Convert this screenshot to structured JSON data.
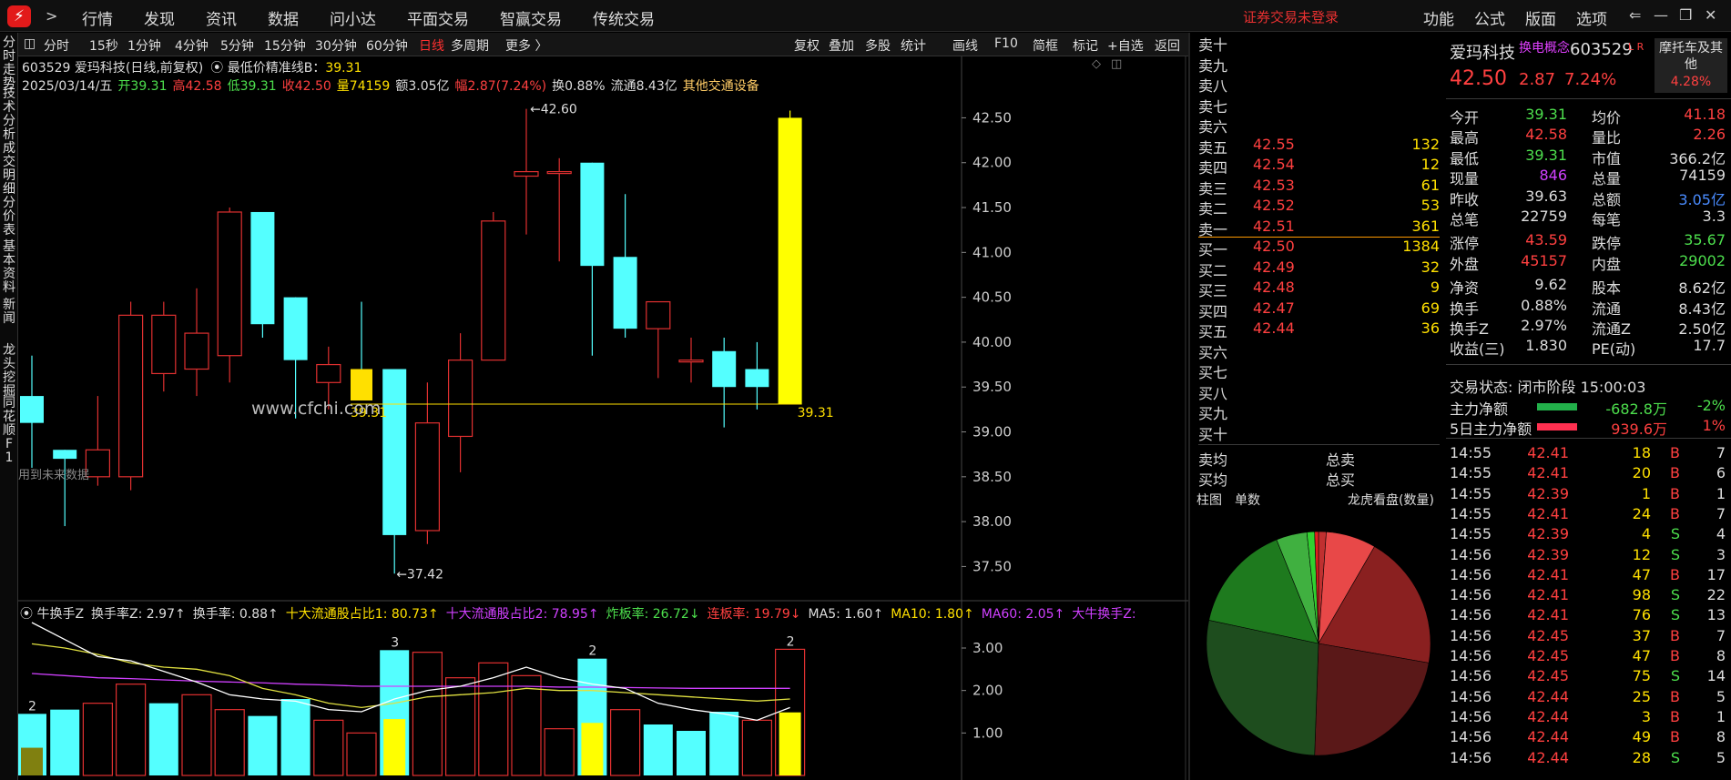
{
  "topbar": {
    "menu": [
      "行情",
      "发现",
      "资讯",
      "数据",
      "问小达",
      "平面交易",
      "智赢交易",
      "传统交易"
    ],
    "status": "证券交易未登录",
    "right_menu": [
      "功能",
      "公式",
      "版面",
      "选项"
    ]
  },
  "leftbar": [
    "分时走势",
    "技术分析",
    "成交明细",
    "分价表",
    "基本资料",
    "新闻",
    "龙头挖掘",
    "同花顺F1"
  ],
  "periods": [
    "分时",
    "15秒",
    "1分钟",
    "4分钟",
    "5分钟",
    "15分钟",
    "30分钟",
    "60分钟",
    "日线",
    "多周期",
    "更多 〉"
  ],
  "tools": [
    "复权",
    "叠加",
    "多股",
    "统计",
    "画线",
    "F10",
    "简框",
    "标记",
    "+自选",
    "返回"
  ],
  "kline_header": {
    "code_name": "603529 爱玛科技(日线,前复权)",
    "line_label": "最低价精准线B：",
    "line_value": "39.31",
    "date": "2025/03/14/五",
    "open": "开39.31",
    "high": "高42.58",
    "low": "低39.31",
    "close": "收42.50",
    "vol": "量74159",
    "amount": "额3.05亿",
    "range": "幅2.87(7.24%)",
    "turnover": "换0.88%",
    "float": "流通8.43亿",
    "industry": "其他交通设备"
  },
  "watermark": "www.cfchi.com",
  "future_note": "用到未来数据",
  "annot": {
    "high": "42.60",
    "low": "37.42",
    "line_left": "39.31",
    "line_right": "39.31"
  },
  "ind_header": {
    "name": "牛换手Z",
    "items": [
      "换手率Z: 2.97↑",
      "换手率: 0.88↑",
      "十大流通股占比1: 80.73↑",
      "十大流通股占比2: 78.95↑",
      "炸板率: 26.72↓",
      "连板率: 19.79↓",
      "MA5: 1.60↑",
      "MA10: 1.80↑",
      "MA60: 2.05↑",
      "大牛换手Z:"
    ]
  },
  "ind_labels": [
    "2",
    "3",
    "2",
    "2"
  ],
  "chart_data": [
    {
      "type": "candlestick",
      "name": "日线",
      "ylim": [
        37.2,
        42.9
      ],
      "yticks": [
        "42.50",
        "42.00",
        "41.50",
        "41.00",
        "40.50",
        "40.00",
        "39.50",
        "39.00",
        "38.50",
        "38.00",
        "37.50"
      ],
      "candles": [
        [
          39.4,
          39.1,
          39.85,
          38.6
        ],
        [
          38.8,
          38.7,
          38.8,
          37.95
        ],
        [
          38.5,
          38.8,
          39.4,
          38.4
        ],
        [
          38.5,
          40.3,
          40.45,
          38.35
        ],
        [
          39.65,
          40.3,
          40.45,
          39.45
        ],
        [
          39.7,
          40.1,
          40.6,
          39.4
        ],
        [
          39.85,
          41.45,
          41.5,
          39.55
        ],
        [
          41.45,
          40.2,
          41.45,
          40.05
        ],
        [
          40.5,
          39.8,
          40.5,
          39.15
        ],
        [
          39.55,
          39.75,
          39.95,
          39.25
        ],
        [
          39.7,
          39.35,
          40.45,
          39.35
        ],
        [
          39.7,
          37.85,
          39.7,
          37.42
        ],
        [
          37.9,
          39.1,
          39.55,
          37.75
        ],
        [
          38.95,
          39.8,
          40.1,
          38.55
        ],
        [
          39.8,
          41.35,
          41.45,
          39.8
        ],
        [
          41.85,
          41.9,
          42.6,
          41.2
        ],
        [
          41.88,
          41.9,
          42.05,
          40.9
        ],
        [
          42.0,
          40.85,
          42.0,
          39.85
        ],
        [
          40.95,
          40.15,
          41.65,
          40.05
        ],
        [
          40.15,
          40.45,
          40.45,
          39.6
        ],
        [
          39.8,
          39.8,
          40.05,
          39.55
        ],
        [
          39.9,
          39.5,
          40.05,
          39.05
        ],
        [
          39.7,
          39.5,
          40.0,
          39.25
        ],
        [
          39.31,
          42.5,
          42.58,
          39.31
        ]
      ]
    },
    {
      "type": "bar",
      "name": "换手率Z",
      "ylim": [
        0,
        3.6
      ],
      "yticks": [
        "3.00",
        "2.00",
        "1.00"
      ],
      "values": [
        1.45,
        1.55,
        1.7,
        2.15,
        1.7,
        1.9,
        1.55,
        1.4,
        1.8,
        1.3,
        1.0,
        2.95,
        2.9,
        2.3,
        2.65,
        2.35,
        1.1,
        2.75,
        1.55,
        1.2,
        1.05,
        1.5,
        1.3,
        2.97
      ],
      "ma_white": [
        3.6,
        3.2,
        2.8,
        2.7,
        2.45,
        2.2,
        1.9,
        1.8,
        1.75,
        1.55,
        1.5,
        1.8,
        2.0,
        2.1,
        2.3,
        2.55,
        2.3,
        2.15,
        2.05,
        1.7,
        1.55,
        1.45,
        1.3,
        1.6
      ],
      "ma_yellow": [
        3.1,
        3.0,
        2.85,
        2.65,
        2.55,
        2.5,
        2.35,
        2.05,
        1.9,
        1.7,
        1.6,
        1.7,
        1.85,
        1.9,
        1.95,
        2.05,
        2.0,
        2.0,
        1.95,
        1.9,
        1.85,
        1.8,
        1.75,
        1.8
      ],
      "ma_purple": [
        2.4,
        2.35,
        2.3,
        2.28,
        2.25,
        2.22,
        2.2,
        2.18,
        2.15,
        2.13,
        2.1,
        2.1,
        2.1,
        2.1,
        2.1,
        2.1,
        2.08,
        2.08,
        2.07,
        2.06,
        2.05,
        2.05,
        2.05,
        2.05
      ]
    }
  ],
  "stock": {
    "name": "爱玛科技",
    "concept": "换电概念",
    "code": "603529",
    "flags": "L R",
    "side": "摩托车及其他",
    "side_pct": "4.28%",
    "price": "42.50",
    "chg": "2.87",
    "pct": "7.24%"
  },
  "order_book": {
    "sells": [
      [
        "卖十",
        "",
        ""
      ],
      [
        "卖九",
        "",
        ""
      ],
      [
        "卖八",
        "",
        ""
      ],
      [
        "卖七",
        "",
        ""
      ],
      [
        "卖六",
        "",
        ""
      ],
      [
        "卖五",
        "42.55",
        "132"
      ],
      [
        "卖四",
        "42.54",
        "12"
      ],
      [
        "卖三",
        "42.53",
        "61"
      ],
      [
        "卖二",
        "42.52",
        "53"
      ],
      [
        "卖一",
        "42.51",
        "361"
      ]
    ],
    "buys": [
      [
        "买一",
        "42.50",
        "1384"
      ],
      [
        "买二",
        "42.49",
        "32"
      ],
      [
        "买三",
        "42.48",
        "9"
      ],
      [
        "买四",
        "42.47",
        "69"
      ],
      [
        "买五",
        "42.44",
        "36"
      ],
      [
        "买六",
        "",
        ""
      ],
      [
        "买七",
        "",
        ""
      ],
      [
        "买八",
        "",
        ""
      ],
      [
        "买九",
        "",
        ""
      ],
      [
        "买十",
        "",
        ""
      ]
    ],
    "avg_sell": "卖均",
    "avg_buy": "买均",
    "total_sell": "总卖",
    "total_buy": "总买"
  },
  "pie": {
    "tabs": [
      "柱图",
      "单数"
    ],
    "title": "龙虎看盘(数量)"
  },
  "stats": [
    [
      "今开",
      "39.31",
      "均价",
      "41.18"
    ],
    [
      "最高",
      "42.58",
      "量比",
      "2.26"
    ],
    [
      "最低",
      "39.31",
      "市值",
      "366.2亿"
    ],
    [
      "现量",
      "846",
      "总量",
      "74159"
    ],
    [
      "昨收",
      "39.63",
      "总额",
      "3.05亿"
    ],
    [
      "总笔",
      "22759",
      "每笔",
      "3.3"
    ],
    [
      "涨停",
      "43.59",
      "跌停",
      "35.67"
    ],
    [
      "外盘",
      "45157",
      "内盘",
      "29002"
    ],
    [
      "净资",
      "9.62",
      "股本",
      "8.62亿"
    ],
    [
      "换手",
      "0.88%",
      "流通",
      "8.43亿"
    ],
    [
      "换手Z",
      "2.97%",
      "流通Z",
      "2.50亿"
    ],
    [
      "收益(三)",
      "1.830",
      "PE(动)",
      "17.7"
    ]
  ],
  "trade_status": "交易状态: 闭市阶段 15:00:03",
  "flows": [
    [
      "主力净额",
      "-682.8万",
      "-2%"
    ],
    [
      "5日主力净额",
      "939.6万",
      "1%"
    ]
  ],
  "ticks": [
    [
      "14:55",
      "42.41",
      "18",
      "B",
      "7"
    ],
    [
      "14:55",
      "42.41",
      "20",
      "B",
      "6"
    ],
    [
      "14:55",
      "42.39",
      "1",
      "B",
      "1"
    ],
    [
      "14:55",
      "42.41",
      "24",
      "B",
      "7"
    ],
    [
      "14:55",
      "42.39",
      "4",
      "S",
      "4"
    ],
    [
      "14:56",
      "42.39",
      "12",
      "S",
      "3"
    ],
    [
      "14:56",
      "42.41",
      "47",
      "B",
      "17"
    ],
    [
      "14:56",
      "42.41",
      "98",
      "S",
      "22"
    ],
    [
      "14:56",
      "42.41",
      "76",
      "S",
      "13"
    ],
    [
      "14:56",
      "42.45",
      "37",
      "B",
      "7"
    ],
    [
      "14:56",
      "42.45",
      "47",
      "B",
      "8"
    ],
    [
      "14:56",
      "42.45",
      "75",
      "S",
      "14"
    ],
    [
      "14:56",
      "42.44",
      "25",
      "B",
      "5"
    ],
    [
      "14:56",
      "42.44",
      "3",
      "B",
      "1"
    ],
    [
      "14:56",
      "42.44",
      "49",
      "B",
      "8"
    ],
    [
      "14:56",
      "42.44",
      "28",
      "S",
      "5"
    ]
  ]
}
